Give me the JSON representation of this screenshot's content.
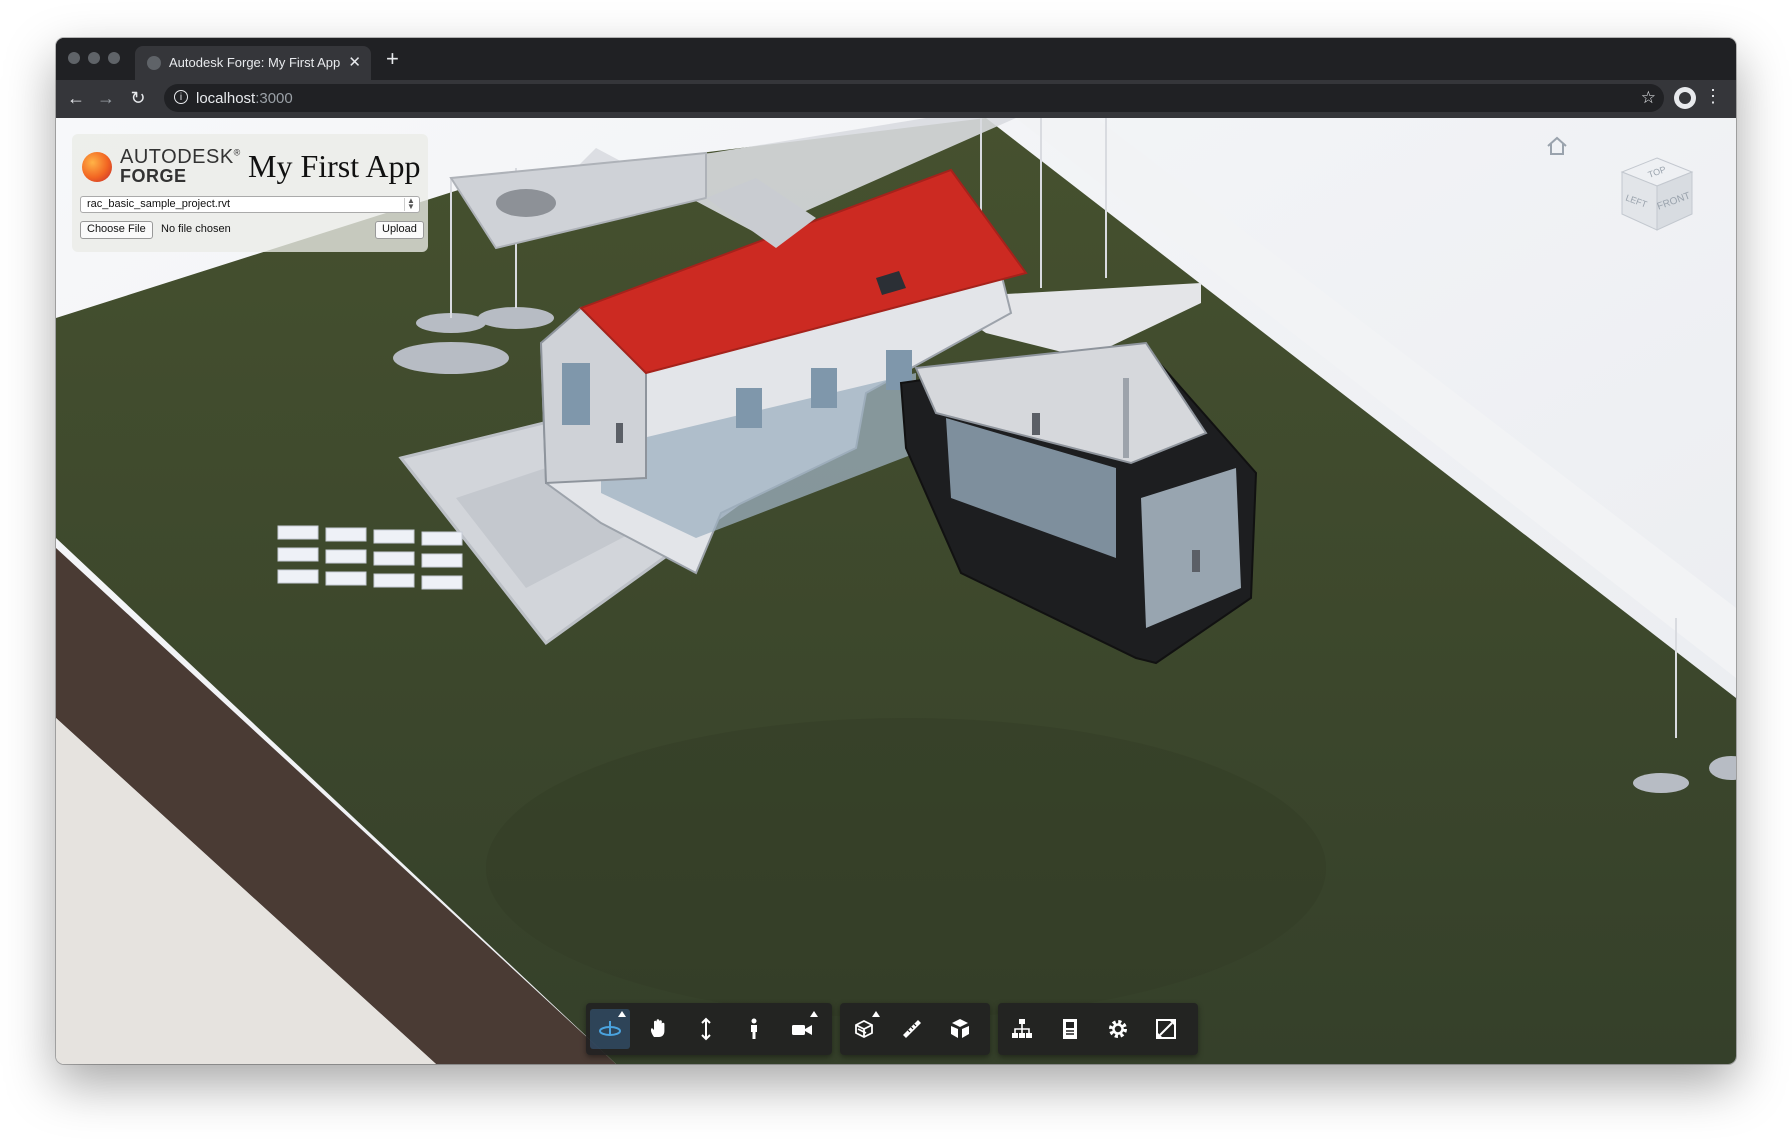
{
  "browser": {
    "tab_title": "Autodesk Forge: My First App",
    "close_glyph": "✕",
    "new_tab_glyph": "+",
    "url_host": "localhost",
    "url_port": ":3000",
    "back_glyph": "←",
    "forward_glyph": "→",
    "reload_glyph": "↻",
    "star_glyph": "☆",
    "menu_glyph": "⋮",
    "info_glyph": "i"
  },
  "app_panel": {
    "brand_line1": "AUTODESK",
    "brand_sup": "®",
    "brand_line2": "FORGE",
    "app_title": "My First App",
    "model_select_value": "rac_basic_sample_project.rvt",
    "choose_file_label": "Choose File",
    "file_status": "No file chosen",
    "upload_label": "Upload"
  },
  "viewer": {
    "home_icon": "home-icon",
    "viewcube_labels": {
      "top": "TOP",
      "left": "LEFT",
      "front": "FRONT"
    },
    "roof_color": "#cc2a22",
    "terrain_color": "#3e4a2c",
    "toolbar_groups": [
      {
        "items": [
          {
            "name": "orbit-icon",
            "active": true,
            "flyout": true
          },
          {
            "name": "pan-icon"
          },
          {
            "name": "zoom-icon"
          },
          {
            "name": "first-person-icon"
          },
          {
            "name": "camera-icon",
            "flyout": true
          }
        ]
      },
      {
        "items": [
          {
            "name": "section-icon",
            "flyout": true
          },
          {
            "name": "measure-icon"
          },
          {
            "name": "explode-icon"
          }
        ]
      },
      {
        "items": [
          {
            "name": "model-browser-icon"
          },
          {
            "name": "properties-icon"
          },
          {
            "name": "settings-icon"
          },
          {
            "name": "fullscreen-icon"
          }
        ]
      }
    ]
  }
}
